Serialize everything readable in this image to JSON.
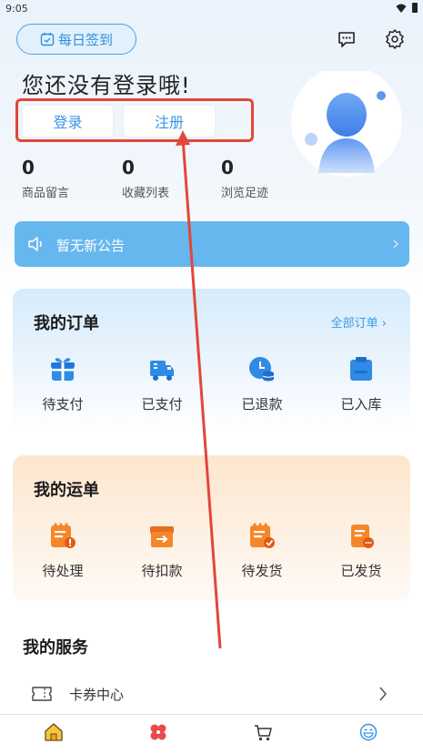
{
  "status": {
    "time": "9:05"
  },
  "header": {
    "checkin_label": "每日签到",
    "login_title": "您还没有登录哦!",
    "login_label": "登录",
    "register_label": "注册"
  },
  "stats": [
    {
      "value": "0",
      "label": "商品留言"
    },
    {
      "value": "0",
      "label": "收藏列表"
    },
    {
      "value": "0",
      "label": "浏览足迹"
    }
  ],
  "notice": {
    "text": "暂无新公告"
  },
  "orders": {
    "title": "我的订单",
    "all_link": "全部订单",
    "items": [
      {
        "label": "待支付",
        "icon": "gift-icon"
      },
      {
        "label": "已支付",
        "icon": "truck-icon"
      },
      {
        "label": "已退款",
        "icon": "refund-icon"
      },
      {
        "label": "已入库",
        "icon": "warehouse-icon"
      }
    ]
  },
  "waybill": {
    "title": "我的运单",
    "items": [
      {
        "label": "待处理",
        "icon": "pending-icon"
      },
      {
        "label": "待扣款",
        "icon": "deduct-icon"
      },
      {
        "label": "待发货",
        "icon": "to-ship-icon"
      },
      {
        "label": "已发货",
        "icon": "shipped-icon"
      }
    ]
  },
  "services": {
    "title": "我的服务",
    "items": [
      {
        "label": "卡券中心",
        "icon": "coupon-icon"
      }
    ]
  },
  "colors": {
    "accent": "#3a95e3",
    "notice_bg": "#66b7ee",
    "orange": "#f5872a",
    "annotation": "#e2473a"
  }
}
